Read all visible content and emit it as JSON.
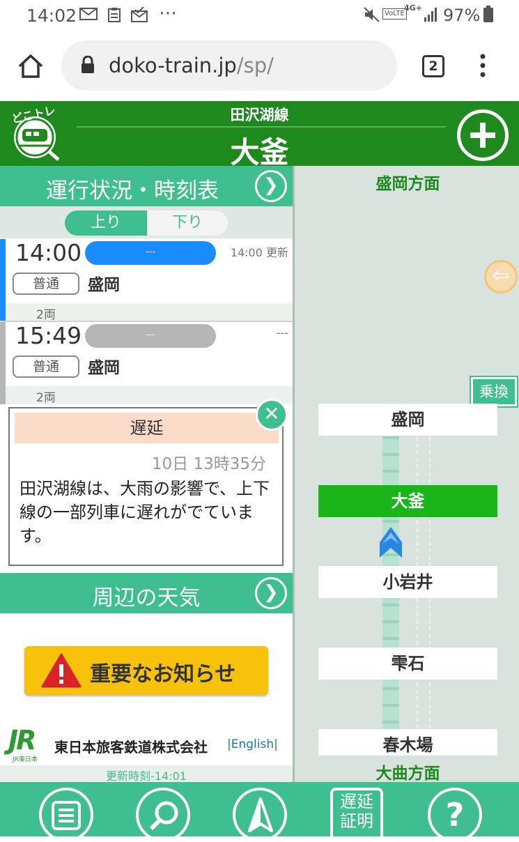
{
  "status_bar": {
    "time": "14:02",
    "left_icons": [
      "mail-icon",
      "clipboard-icon",
      "mail-check-icon",
      "more-dots-icon"
    ],
    "right_icons": [
      "mute-icon",
      "volte-icon",
      "4g-icon",
      "signal-icon"
    ],
    "volte": "VoLTE",
    "network": "4G+",
    "battery": "97%"
  },
  "browser": {
    "url_domain": "doko-train.jp",
    "url_path": "/sp/",
    "tab_count": "2"
  },
  "header": {
    "line_name": "田沢湖線",
    "station_name": "大釜",
    "logo_text": "どこトレ"
  },
  "left": {
    "status_title": "運行状況・時刻表",
    "direction_tabs": {
      "up": "上り",
      "down": "下り",
      "selected": "up"
    },
    "trains": [
      {
        "time": "14:00",
        "pill": "---",
        "update": "14:00 更新",
        "kind": "普通",
        "destination": "盛岡",
        "cars": "2両",
        "color": "#1a8cff"
      },
      {
        "time": "15:49",
        "pill": "---",
        "update": "---",
        "kind": "普通",
        "destination": "盛岡",
        "cars": "2両",
        "color": "#b5b5b5"
      }
    ],
    "delay": {
      "title": "遅延",
      "date": "10日 13時35分",
      "message": "田沢湖線は、大雨の影響で、上下線の一部列車に遅れがでています。"
    },
    "weather_title": "周辺の天気",
    "notice_label": "重要なお知らせ",
    "jr_logo_text": "JR",
    "jr_logo_sub": "JR東日本",
    "company": "東日本旅客鉄道株式会社",
    "english_link": "|English|",
    "update_time": "更新時刻-14:01"
  },
  "right": {
    "top_direction": "盛岡方面",
    "bottom_direction": "大曲方面",
    "transfer_label": "乗換",
    "stations": [
      {
        "name": "盛岡",
        "current": false
      },
      {
        "name": "大釜",
        "current": true
      },
      {
        "name": "小岩井",
        "current": false
      },
      {
        "name": "雫石",
        "current": false
      },
      {
        "name": "春木場",
        "current": false
      }
    ]
  },
  "bottom_nav": {
    "items": [
      {
        "icon": "list-icon"
      },
      {
        "icon": "search-icon"
      },
      {
        "icon": "navigation-arrow-icon"
      },
      {
        "icon": "delay-certificate-icon",
        "label_top": "遅延",
        "label_bottom": "証明"
      },
      {
        "icon": "help-icon",
        "label": "?"
      }
    ]
  },
  "colors": {
    "header_green": "#1e8a1e",
    "accent_teal": "#3fbf8f",
    "current_station": "#19b519",
    "notice_yellow": "#f8c20a"
  }
}
